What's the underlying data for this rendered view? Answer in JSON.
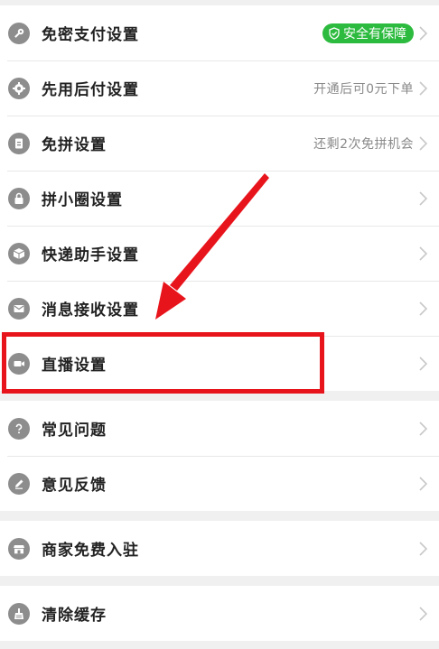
{
  "colors": {
    "badge_green": "#2dbb3f",
    "annotation_red": "#e8141c",
    "icon_gray": "#8d8d8d"
  },
  "group1": [
    {
      "label": "免密支付设置",
      "icon": "key-icon",
      "badge": "安全有保障"
    },
    {
      "label": "先用后付设置",
      "icon": "gear-icon",
      "hint": "开通后可0元下单"
    },
    {
      "label": "免拼设置",
      "icon": "document-icon",
      "hint": "还剩2次免拼机会"
    },
    {
      "label": "拼小圈设置",
      "icon": "lock-icon"
    },
    {
      "label": "快递助手设置",
      "icon": "package-icon"
    },
    {
      "label": "消息接收设置",
      "icon": "envelope-icon"
    },
    {
      "label": "直播设置",
      "icon": "video-camera-icon"
    }
  ],
  "group2": [
    {
      "label": "常见问题",
      "icon": "question-icon"
    },
    {
      "label": "意见反馈",
      "icon": "pencil-icon"
    }
  ],
  "group3": [
    {
      "label": "商家免费入驻",
      "icon": "store-icon"
    }
  ],
  "group4": [
    {
      "label": "清除缓存",
      "icon": "broom-icon"
    }
  ]
}
